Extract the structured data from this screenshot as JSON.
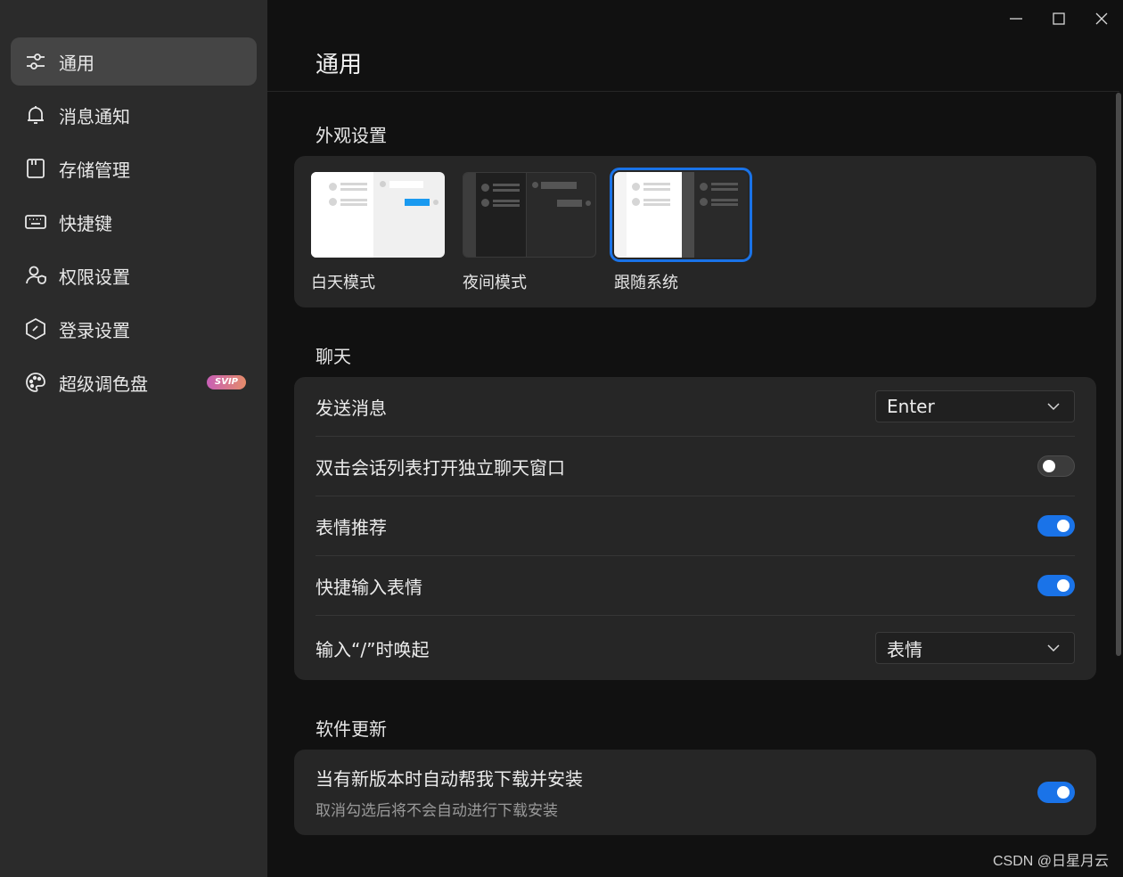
{
  "sidebar": {
    "items": [
      {
        "label": "通用",
        "icon": "sliders-icon",
        "active": true
      },
      {
        "label": "消息通知",
        "icon": "bell-icon"
      },
      {
        "label": "存储管理",
        "icon": "storage-card-icon"
      },
      {
        "label": "快捷键",
        "icon": "keyboard-icon"
      },
      {
        "label": "权限设置",
        "icon": "user-shield-icon"
      },
      {
        "label": "登录设置",
        "icon": "hexagon-login-icon"
      },
      {
        "label": "超级调色盘",
        "icon": "palette-icon",
        "badge": "SVIP"
      }
    ]
  },
  "window": {
    "controls": [
      "minimize-icon",
      "maximize-icon",
      "close-icon"
    ]
  },
  "header": {
    "title": "通用"
  },
  "appearance": {
    "section_title": "外观设置",
    "options": [
      {
        "label": "白天模式",
        "selected": false
      },
      {
        "label": "夜间模式",
        "selected": false
      },
      {
        "label": "跟随系统",
        "selected": true
      }
    ]
  },
  "chat": {
    "section_title": "聊天",
    "send_message": {
      "label": "发送消息",
      "value": "Enter"
    },
    "double_click_open": {
      "label": "双击会话列表打开独立聊天窗口",
      "on": false
    },
    "emoji_recommend": {
      "label": "表情推荐",
      "on": true
    },
    "quick_emoji": {
      "label": "快捷输入表情",
      "on": true
    },
    "slash_invoke": {
      "label": "输入“/”时唤起",
      "value": "表情"
    }
  },
  "update": {
    "section_title": "软件更新",
    "auto_update": {
      "label": "当有新版本时自动帮我下载并安装",
      "sub": "取消勾选后将不会自动进行下载安装",
      "on": true
    }
  },
  "colors": {
    "accent": "#1a73e8",
    "sidebar_bg": "#2b2b2b",
    "main_bg": "#111111",
    "card_bg": "#262626"
  },
  "watermark": "CSDN @日星月云"
}
